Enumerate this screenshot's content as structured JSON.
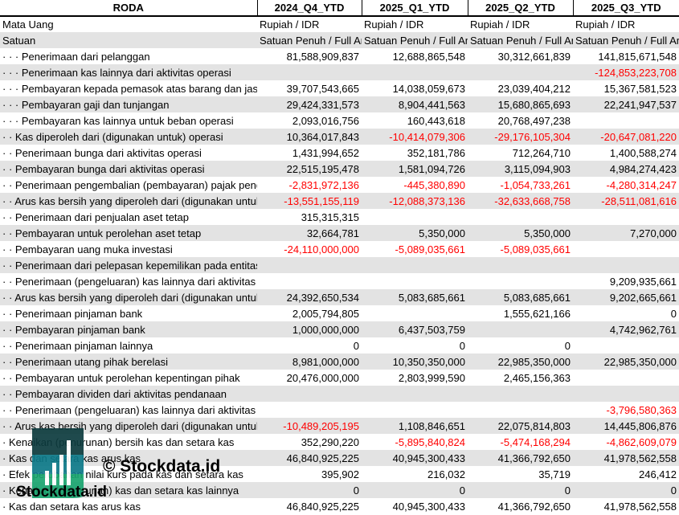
{
  "header": {
    "title": "RODA",
    "periods": [
      "2024_Q4_YTD",
      "2025_Q1_YTD",
      "2025_Q2_YTD",
      "2025_Q3_YTD"
    ]
  },
  "meta_rows": [
    {
      "label": "Mata Uang",
      "values": [
        "Rupiah / IDR",
        "Rupiah / IDR",
        "Rupiah / IDR",
        "Rupiah / IDR"
      ]
    },
    {
      "label": "Satuan",
      "values": [
        "Satuan Penuh / Full Amount",
        "Satuan Penuh / Full Amount",
        "Satuan Penuh / Full Amount",
        "Satuan Penuh / Full Amount"
      ]
    }
  ],
  "rows": [
    {
      "indent": "· · ·",
      "label": "Penerimaan dari pelanggan",
      "values": [
        "81,588,909,837",
        "12,688,865,548",
        "30,312,661,839",
        "141,815,671,548"
      ]
    },
    {
      "indent": "· · ·",
      "label": "Penerimaan kas lainnya dari aktivitas operasi",
      "values": [
        "",
        "",
        "",
        "-124,853,223,708"
      ]
    },
    {
      "indent": "· · ·",
      "label": "Pembayaran kepada pemasok atas barang dan jasa",
      "values": [
        "39,707,543,665",
        "14,038,059,673",
        "23,039,404,212",
        "15,367,581,523"
      ]
    },
    {
      "indent": "· · ·",
      "label": "Pembayaran gaji dan tunjangan",
      "values": [
        "29,424,331,573",
        "8,904,441,563",
        "15,680,865,693",
        "22,241,947,537"
      ]
    },
    {
      "indent": "· · ·",
      "label": "Pembayaran kas lainnya untuk beban operasi",
      "values": [
        "2,093,016,756",
        "160,443,618",
        "20,768,497,238",
        ""
      ]
    },
    {
      "indent": "· ·",
      "label": "Kas diperoleh dari (digunakan untuk) operasi",
      "values": [
        "10,364,017,843",
        "-10,414,079,306",
        "-29,176,105,304",
        "-20,647,081,220"
      ]
    },
    {
      "indent": "· ·",
      "label": "Penerimaan bunga dari aktivitas operasi",
      "values": [
        "1,431,994,652",
        "352,181,786",
        "712,264,710",
        "1,400,588,274"
      ]
    },
    {
      "indent": "· ·",
      "label": "Pembayaran bunga dari aktivitas operasi",
      "values": [
        "22,515,195,478",
        "1,581,094,726",
        "3,115,094,903",
        "4,984,274,423"
      ]
    },
    {
      "indent": "· ·",
      "label": "Penerimaan pengembalian (pembayaran) pajak penghasilan",
      "values": [
        "-2,831,972,136",
        "-445,380,890",
        "-1,054,733,261",
        "-4,280,314,247"
      ]
    },
    {
      "indent": "· ·",
      "label": "Arus kas bersih yang diperoleh dari (digunakan untuk) aktivitas operasi",
      "values": [
        "-13,551,155,119",
        "-12,088,373,136",
        "-32,633,668,758",
        "-28,511,081,616"
      ]
    },
    {
      "indent": "· ·",
      "label": "Penerimaan dari penjualan aset tetap",
      "values": [
        "315,315,315",
        "",
        "",
        ""
      ]
    },
    {
      "indent": "· ·",
      "label": "Pembayaran untuk perolehan aset tetap",
      "values": [
        "32,664,781",
        "5,350,000",
        "5,350,000",
        "7,270,000"
      ]
    },
    {
      "indent": "· ·",
      "label": "Pembayaran uang muka investasi",
      "values": [
        "-24,110,000,000",
        "-5,089,035,661",
        "-5,089,035,661",
        ""
      ]
    },
    {
      "indent": "· ·",
      "label": "Penerimaan dari pelepasan kepemilikan pada entitas asosiasi",
      "values": [
        "",
        "",
        "",
        ""
      ]
    },
    {
      "indent": "· ·",
      "label": "Penerimaan (pengeluaran) kas lainnya dari aktivitas investasi",
      "values": [
        "",
        "",
        "",
        "9,209,935,661"
      ]
    },
    {
      "indent": "· ·",
      "label": "Arus kas bersih yang diperoleh dari (digunakan untuk) aktivitas investasi",
      "values": [
        "24,392,650,534",
        "5,083,685,661",
        "5,083,685,661",
        "9,202,665,661"
      ]
    },
    {
      "indent": "· ·",
      "label": "Penerimaan pinjaman bank",
      "values": [
        "2,005,794,805",
        "",
        "1,555,621,166",
        "0"
      ]
    },
    {
      "indent": "· ·",
      "label": "Pembayaran pinjaman bank",
      "values": [
        "1,000,000,000",
        "6,437,503,759",
        "",
        "4,742,962,761"
      ]
    },
    {
      "indent": "· ·",
      "label": "Penerimaan pinjaman lainnya",
      "values": [
        "0",
        "0",
        "0",
        ""
      ]
    },
    {
      "indent": "· ·",
      "label": "Penerimaan utang pihak berelasi",
      "values": [
        "8,981,000,000",
        "10,350,350,000",
        "22,985,350,000",
        "22,985,350,000"
      ]
    },
    {
      "indent": "· ·",
      "label": "Pembayaran untuk perolehan kepentingan pihak",
      "values": [
        "20,476,000,000",
        "2,803,999,590",
        "2,465,156,363",
        ""
      ]
    },
    {
      "indent": "· ·",
      "label": "Pembayaran dividen dari aktivitas pendanaan",
      "values": [
        "",
        "",
        "",
        ""
      ]
    },
    {
      "indent": "· ·",
      "label": "Penerimaan (pengeluaran) kas lainnya dari aktivitas pendanaan",
      "values": [
        "",
        "",
        "",
        "-3,796,580,363"
      ]
    },
    {
      "indent": "· ·",
      "label": "Arus kas bersih yang diperoleh dari (digunakan untuk) aktivitas pendanaan",
      "values": [
        "-10,489,205,195",
        "1,108,846,651",
        "22,075,814,803",
        "14,445,806,876"
      ]
    },
    {
      "indent": "·",
      "label": "Kenaikan (penurunan) bersih kas dan setara kas",
      "values": [
        "352,290,220",
        "-5,895,840,824",
        "-5,474,168,294",
        "-4,862,609,079"
      ]
    },
    {
      "indent": "·",
      "label": "Kas dan setara kas arus kas",
      "values": [
        "46,840,925,225",
        "40,945,300,433",
        "41,366,792,650",
        "41,978,562,558"
      ]
    },
    {
      "indent": "·",
      "label": "Efek perubahan nilai kurs pada kas dan setara kas",
      "values": [
        "395,902",
        "216,032",
        "35,719",
        "246,412"
      ]
    },
    {
      "indent": "·",
      "label": "Kenaikan (penurunan) kas dan setara kas lainnya",
      "values": [
        "0",
        "0",
        "0",
        "0"
      ]
    },
    {
      "indent": "·",
      "label": "Kas dan setara kas arus kas",
      "values": [
        "46,840,925,225",
        "40,945,300,433",
        "41,366,792,650",
        "41,978,562,558"
      ]
    }
  ],
  "watermark": {
    "text_main": "© Stockdata.id",
    "text_logo": "Stockdata.id"
  },
  "colors": {
    "negative": "#ff0000",
    "stripe": "#e3e3e3",
    "logo_dark": "#0d3b3e",
    "logo_teal": "#0e7c8c",
    "logo_green": "#1aa56f"
  }
}
